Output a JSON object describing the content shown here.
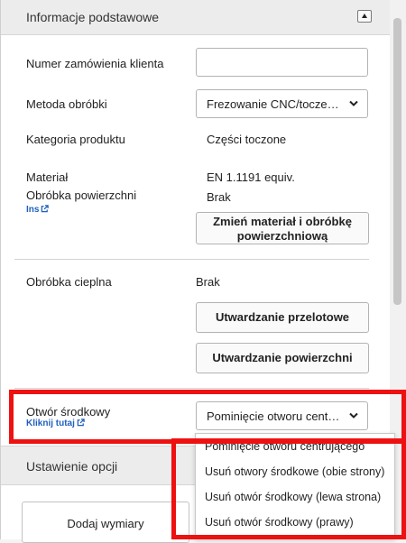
{
  "header": {
    "title": "Informacje podstawowe"
  },
  "fields": {
    "order_number": {
      "label": "Numer zamówienia klienta",
      "value": ""
    },
    "processing_method": {
      "label": "Metoda obróbki",
      "selected": "Frezowanie CNC/tocze…"
    },
    "product_category": {
      "label": "Kategoria produktu",
      "value": "Części toczone"
    },
    "material": {
      "label": "Materiał",
      "value": "EN 1.1191 equiv."
    },
    "surface_treatment": {
      "label": "Obróbka powierzchni",
      "value": "Brak",
      "link": "Ins"
    },
    "change_button": {
      "line1": "Zmień materiał i obróbkę",
      "line2": "powierzchniową"
    },
    "heat_treatment": {
      "label": "Obróbka cieplna",
      "value": "Brak"
    },
    "through_hardening_button": "Utwardzanie przelotowe",
    "surface_hardening_button": "Utwardzanie powierzchni",
    "center_hole": {
      "label": "Otwór środkowy",
      "link": "Kliknij tutaj",
      "selected": "Pominięcie otworu cent…",
      "options": [
        "Pominięcie otworu centrującego",
        "Usuń otwory środkowe (obie strony)",
        "Usuń otwór środkowy (lewa strona)",
        "Usuń otwór środkowy (prawy)"
      ]
    }
  },
  "options_section": {
    "title": "Ustawienie opcji",
    "add_dimensions_button": "Dodaj wymiary"
  },
  "colors": {
    "highlight": "#ee1111",
    "link": "#1f5fbf",
    "header_bg": "#ececec"
  },
  "icons": {
    "collapse": "chevron-up-icon",
    "dropdown": "chevron-down-icon",
    "external": "external-link-icon"
  }
}
